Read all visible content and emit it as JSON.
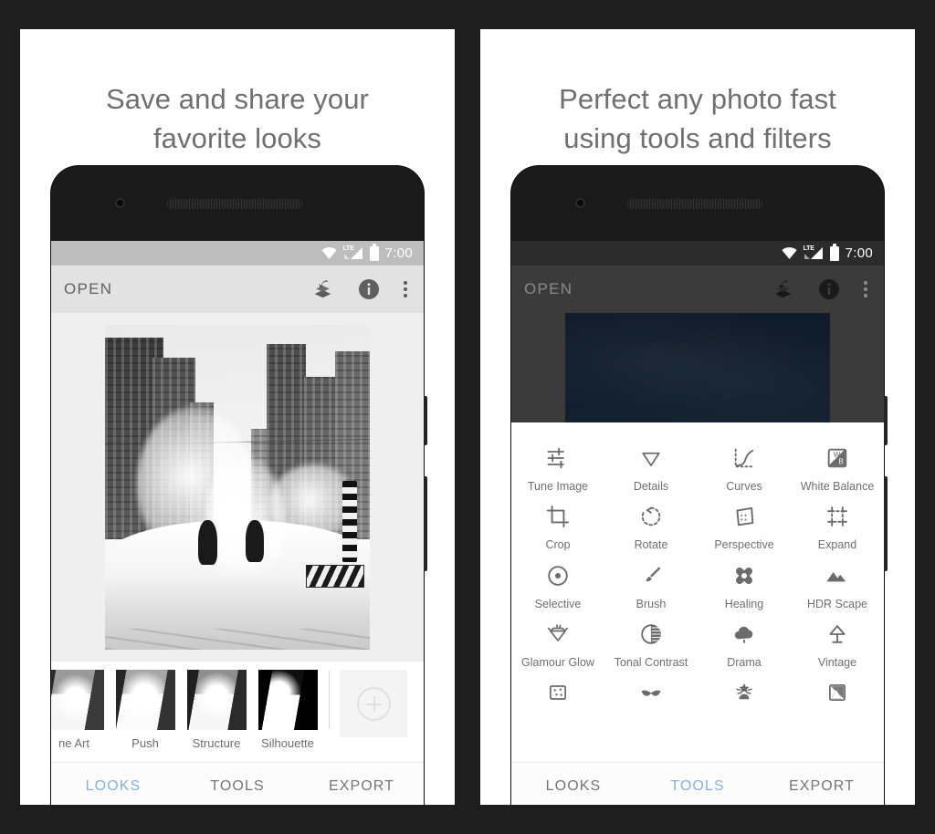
{
  "theme": {
    "background": "#1e1e1e",
    "card": "#ffffff",
    "headline_color": "#6f6f6f",
    "accent_tab": "#85b0dd",
    "statusbar_light": "#bdbdbd",
    "appbar_light": "#e2e2e2"
  },
  "panels": [
    {
      "headline_line1": "Save and share your",
      "headline_line2": "favorite looks",
      "status_bar": {
        "time": "7:00",
        "icons": [
          "wifi-icon",
          "lte-signal-icon",
          "battery-icon"
        ],
        "network_label": "LTE"
      },
      "app_bar": {
        "title": "OPEN",
        "actions": [
          "stack-undo-icon",
          "info-icon",
          "overflow-menu-icon"
        ]
      },
      "photo": {
        "description": "Black and white photo of a snowy city street with steam rising between buildings"
      },
      "filmstrip": {
        "thumbnails": [
          {
            "label": "ne Art"
          },
          {
            "label": "Push"
          },
          {
            "label": "Structure"
          },
          {
            "label": "Silhouette"
          }
        ],
        "add_button": "add-look-button"
      },
      "tabs": [
        {
          "label": "LOOKS",
          "active": true
        },
        {
          "label": "TOOLS",
          "active": false
        },
        {
          "label": "EXPORT",
          "active": false
        }
      ]
    },
    {
      "headline_line1": "Perfect any photo fast",
      "headline_line2": "using tools and filters",
      "status_bar": {
        "time": "7:00",
        "icons": [
          "wifi-icon",
          "lte-signal-icon",
          "battery-icon"
        ],
        "network_label": "LTE"
      },
      "app_bar": {
        "title": "OPEN",
        "actions": [
          "stack-undo-icon",
          "info-icon",
          "overflow-menu-icon"
        ]
      },
      "photo": {
        "description": "Dimmed dark navy photo behind the tools sheet"
      },
      "tools": [
        [
          {
            "label": "Tune Image",
            "icon": "sliders-icon"
          },
          {
            "label": "Details",
            "icon": "triangle-down-icon"
          },
          {
            "label": "Curves",
            "icon": "curves-icon"
          },
          {
            "label": "White Balance",
            "icon": "white-balance-icon"
          }
        ],
        [
          {
            "label": "Crop",
            "icon": "crop-icon"
          },
          {
            "label": "Rotate",
            "icon": "rotate-icon"
          },
          {
            "label": "Perspective",
            "icon": "perspective-icon"
          },
          {
            "label": "Expand",
            "icon": "expand-icon"
          }
        ],
        [
          {
            "label": "Selective",
            "icon": "target-dot-icon"
          },
          {
            "label": "Brush",
            "icon": "brush-icon"
          },
          {
            "label": "Healing",
            "icon": "healing-bandage-icon"
          },
          {
            "label": "HDR Scape",
            "icon": "mountains-icon"
          }
        ],
        [
          {
            "label": "Glamour Glow",
            "icon": "gem-icon"
          },
          {
            "label": "Tonal Contrast",
            "icon": "half-circle-icon"
          },
          {
            "label": "Drama",
            "icon": "cloud-rain-icon"
          },
          {
            "label": "Vintage",
            "icon": "lamp-icon"
          }
        ],
        [
          {
            "label": "",
            "icon": "grainy-film-icon"
          },
          {
            "label": "",
            "icon": "retrolux-mustache-icon"
          },
          {
            "label": "",
            "icon": "grunge-icon"
          },
          {
            "label": "",
            "icon": "black-and-white-icon"
          }
        ]
      ],
      "tabs": [
        {
          "label": "LOOKS",
          "active": false
        },
        {
          "label": "TOOLS",
          "active": true
        },
        {
          "label": "EXPORT",
          "active": false
        }
      ]
    }
  ]
}
